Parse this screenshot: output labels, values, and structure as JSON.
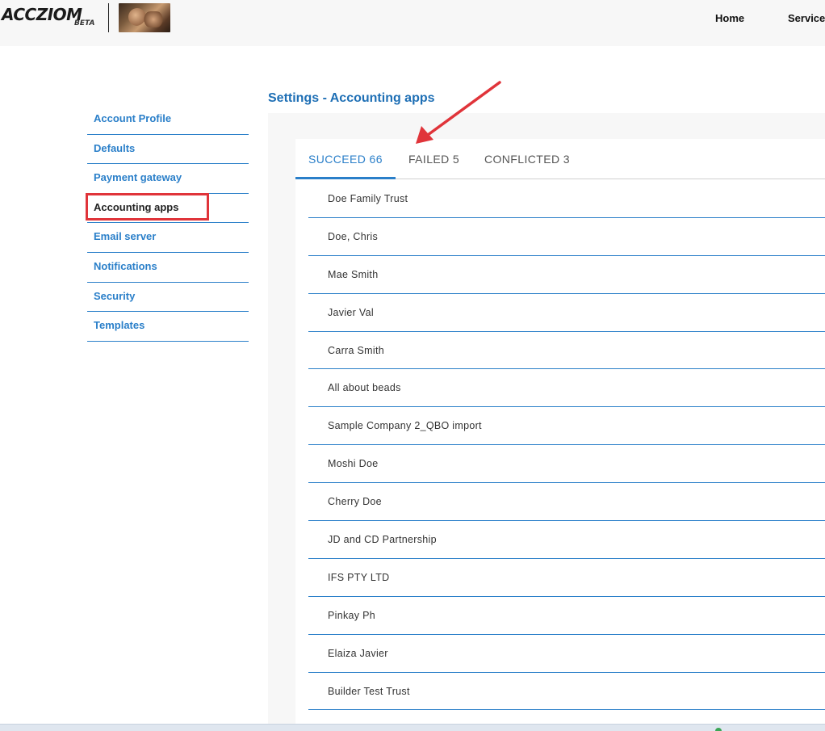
{
  "header": {
    "logo_text": "ACCZIOM",
    "logo_badge": "BETA",
    "nav": [
      {
        "label": "Home"
      },
      {
        "label": "Services"
      }
    ]
  },
  "sidebar": {
    "items": [
      {
        "label": "Account Profile"
      },
      {
        "label": "Defaults"
      },
      {
        "label": "Payment gateway"
      },
      {
        "label": "Accounting apps",
        "active": true
      },
      {
        "label": "Email server"
      },
      {
        "label": "Notifications"
      },
      {
        "label": "Security"
      },
      {
        "label": "Templates"
      }
    ]
  },
  "main": {
    "title": "Settings - Accounting apps",
    "tabs": [
      {
        "label": "SUCCEED 66",
        "active": true
      },
      {
        "label": "FAILED 5"
      },
      {
        "label": "CONFLICTED 3"
      }
    ],
    "rows": [
      "Doe Family Trust",
      "Doe, Chris",
      "Mae Smith",
      "Javier Val",
      "Carra Smith",
      "All about beads",
      "Sample Company 2_QBO import",
      "Moshi Doe",
      "Cherry Doe",
      "JD and CD Partnership",
      "IFS PTY LTD",
      "Pinkay Ph",
      "Elaiza Javier",
      "Builder Test Trust"
    ]
  },
  "colors": {
    "accent": "#2a7fc9",
    "title": "#1e6fb5",
    "annotation": "#e0343a"
  }
}
